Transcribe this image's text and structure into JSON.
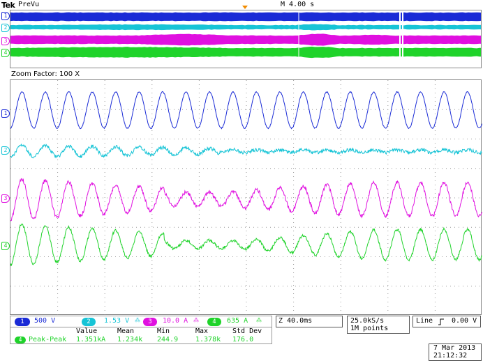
{
  "header": {
    "brand": "Tek",
    "mode": "PreVu",
    "timebase": "M 4.00 s"
  },
  "zoom": {
    "label": "Zoom Factor: 100 X"
  },
  "channels": [
    {
      "id": "1",
      "scale": "500 V",
      "color": "#1a2bd6",
      "suffix": ""
    },
    {
      "id": "2",
      "scale": "1.53 V",
      "color": "#17c4d6",
      "suffix": "⁂"
    },
    {
      "id": "3",
      "scale": "10.0 A",
      "color": "#e010e0",
      "suffix": "⁂"
    },
    {
      "id": "4",
      "scale": "635 A",
      "color": "#1fd32a",
      "suffix": "⁂"
    }
  ],
  "horizontal": {
    "zoom_scale": "Z 40.0ms",
    "sample_rate": "25.0kS/s",
    "record_length": "1M points"
  },
  "trigger": {
    "type": "Line",
    "level": "0.00 V"
  },
  "measurement": {
    "headers": [
      "Value",
      "Mean",
      "Min",
      "Max",
      "Std Dev"
    ],
    "channel": "4",
    "name": "Peak-Peak",
    "values": [
      "1.351kA",
      "1.234k",
      "244.9",
      "1.378k",
      "176.0"
    ]
  },
  "datetime": {
    "date": "7 Mar 2013",
    "time": "21:12:32"
  },
  "colors": {
    "ch1": "#1a2bd6",
    "ch2": "#17c4d6",
    "ch3": "#e010e0",
    "ch4": "#1fd32a",
    "grid": "#9a9a9a"
  }
}
